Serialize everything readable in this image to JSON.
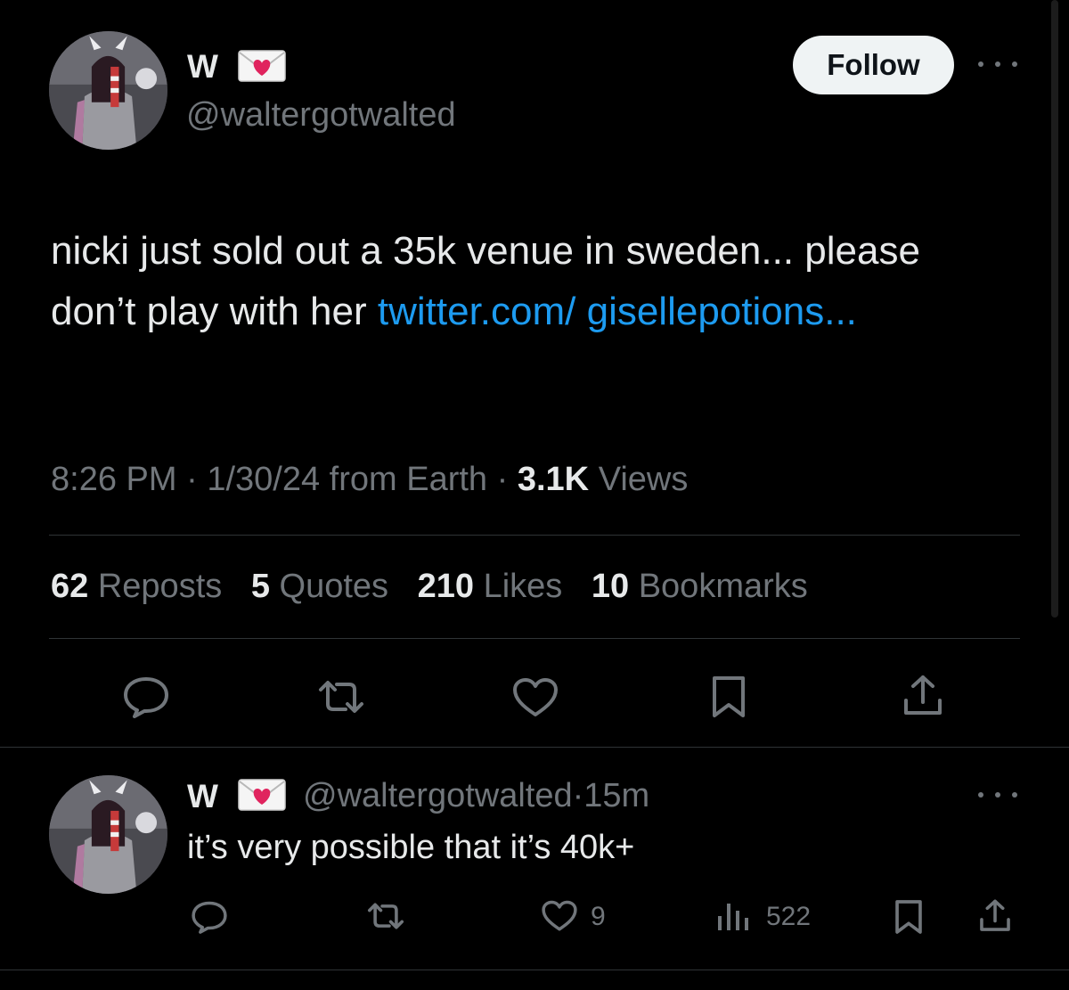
{
  "tweet": {
    "display_name": "W",
    "name_badge_icon": "envelope-with-heart-icon",
    "handle": "@waltergotwalted",
    "follow_label": "Follow",
    "text_prefix": "nicki just sold out a 35k venue in sweden... please don’t play with her ",
    "link_text": "twitter.com/ gisellepotions...",
    "time": "8:26 PM",
    "date": "1/30/24",
    "source": "from Earth",
    "views_count": "3.1K",
    "views_label": "Views",
    "stats": [
      {
        "count": "62",
        "label": "Reposts"
      },
      {
        "count": "5",
        "label": "Quotes"
      },
      {
        "count": "210",
        "label": "Likes"
      },
      {
        "count": "10",
        "label": "Bookmarks"
      }
    ],
    "actions": [
      "reply-icon",
      "repost-icon",
      "like-icon",
      "bookmark-icon",
      "share-icon"
    ]
  },
  "reply": {
    "display_name": "W",
    "handle": "@waltergotwalted",
    "separator": "·",
    "time_ago": "15m",
    "text": "it’s very possible that it’s 40k+",
    "likes": "9",
    "views": "522"
  },
  "colors": {
    "background": "#000000",
    "text": "#e7e9ea",
    "muted": "#71767b",
    "link": "#1d9bf0",
    "divider": "#2f3336",
    "follow_bg": "#eff3f4"
  }
}
